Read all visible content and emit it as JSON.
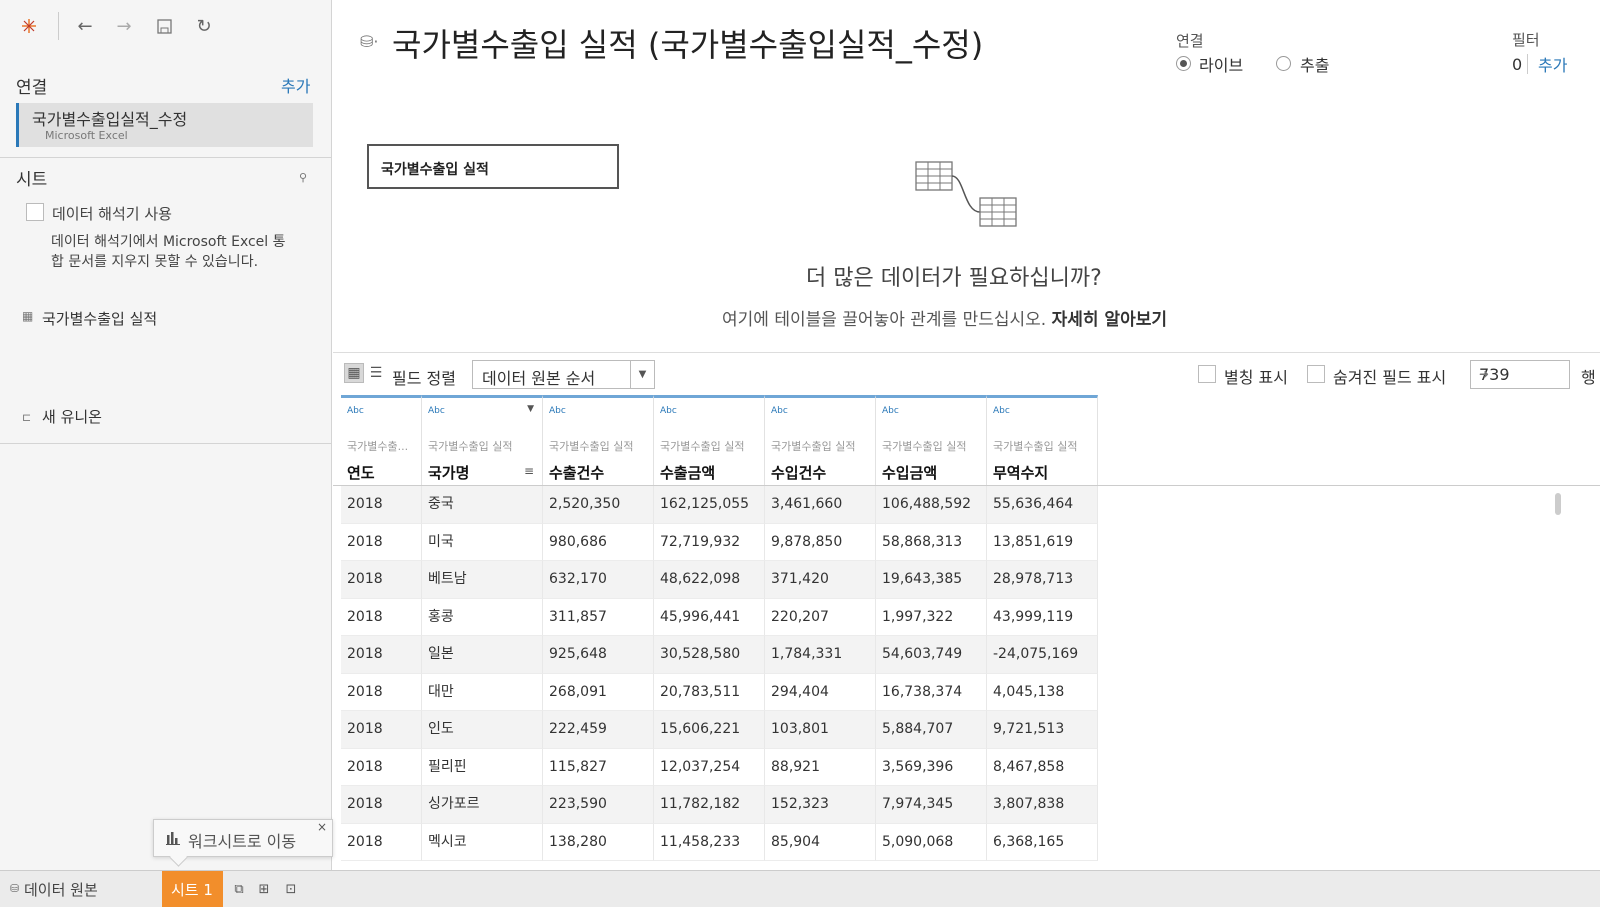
{
  "toolbar": {
    "logo_icon": "tableau-logo-icon",
    "back_icon": "←",
    "forward_icon": "→",
    "save_icon": "save-icon",
    "refresh_icon": "↻"
  },
  "sidebar": {
    "connections_title": "연결",
    "connections_add": "추가",
    "connection": {
      "name": "국가별수출입실적_수정",
      "type": "Microsoft Excel"
    },
    "sheets_title": "시트",
    "interpreter_label": "데이터 해석기 사용",
    "interpreter_note": "데이터 해석기에서 Microsoft Excel 통합 문서를 지우지 못할 수 있습니다.",
    "sheet_item": "국가별수출입 실적",
    "new_union": "새 유니온",
    "tooltip_label": "워크시트로 이동",
    "tooltip_close": "×"
  },
  "header": {
    "title": "국가별수출입 실적 (국가별수출입실적_수정)",
    "connection_title": "연결",
    "live_label": "라이브",
    "extract_label": "추출",
    "filter_title": "필터",
    "filter_count": "0",
    "filter_add": "추가"
  },
  "canvas": {
    "table_name": "국가별수출입 실적",
    "more_title": "더 많은 데이터가 필요하십니까?",
    "more_sub": "여기에 테이블을 끌어놓아 관계를 만드십시오.",
    "more_link": "자세히 알아보기"
  },
  "grid_toolbar": {
    "sort_label": "필드 정렬",
    "sort_value": "데이터 원본 순서",
    "alias_label": "별칭 표시",
    "hidden_label": "숨겨진 필드 표시",
    "rows_value": "739",
    "rows_unit": "행"
  },
  "grid": {
    "columns": [
      {
        "type": "Abc",
        "source": "국가별수출...",
        "name": "연도"
      },
      {
        "type": "Abc",
        "source": "국가별수출입 실적",
        "name": "국가명"
      },
      {
        "type": "Abc",
        "source": "국가별수출입 실적",
        "name": "수출건수"
      },
      {
        "type": "Abc",
        "source": "국가별수출입 실적",
        "name": "수출금액"
      },
      {
        "type": "Abc",
        "source": "국가별수출입 실적",
        "name": "수입건수"
      },
      {
        "type": "Abc",
        "source": "국가별수출입 실적",
        "name": "수입금액"
      },
      {
        "type": "Abc",
        "source": "국가별수출입 실적",
        "name": "무역수지"
      }
    ],
    "rows": [
      [
        "2018",
        "중국",
        "2,520,350",
        "162,125,055",
        "3,461,660",
        "106,488,592",
        "55,636,464"
      ],
      [
        "2018",
        "미국",
        "980,686",
        "72,719,932",
        "9,878,850",
        "58,868,313",
        "13,851,619"
      ],
      [
        "2018",
        "베트남",
        "632,170",
        "48,622,098",
        "371,420",
        "19,643,385",
        "28,978,713"
      ],
      [
        "2018",
        "홍콩",
        "311,857",
        "45,996,441",
        "220,207",
        "1,997,322",
        "43,999,119"
      ],
      [
        "2018",
        "일본",
        "925,648",
        "30,528,580",
        "1,784,331",
        "54,603,749",
        "-24,075,169"
      ],
      [
        "2018",
        "대만",
        "268,091",
        "20,783,511",
        "294,404",
        "16,738,374",
        "4,045,138"
      ],
      [
        "2018",
        "인도",
        "222,459",
        "15,606,221",
        "103,801",
        "5,884,707",
        "9,721,513"
      ],
      [
        "2018",
        "필리핀",
        "115,827",
        "12,037,254",
        "88,921",
        "3,569,396",
        "8,467,858"
      ],
      [
        "2018",
        "싱가포르",
        "223,590",
        "11,782,182",
        "152,323",
        "7,974,345",
        "3,807,838"
      ],
      [
        "2018",
        "멕시코",
        "138,280",
        "11,458,233",
        "85,904",
        "5,090,068",
        "6,368,165"
      ]
    ]
  },
  "bottom": {
    "datasource_tab": "데이터 원본",
    "sheet_tab": "시트 1"
  },
  "colors": {
    "accent": "#2a78b8",
    "sheet_tab": "#f28e2b"
  }
}
